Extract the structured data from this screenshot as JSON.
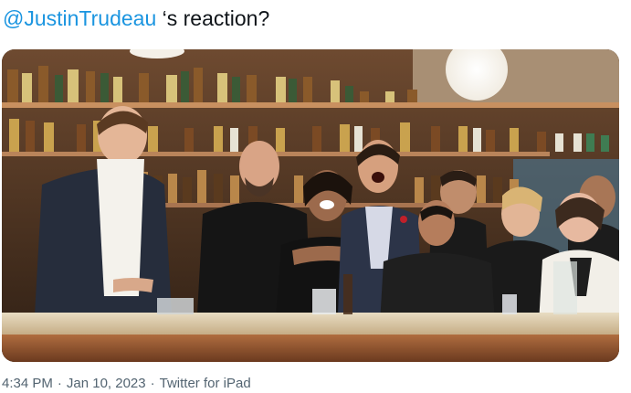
{
  "tweet": {
    "mention": "@JustinTrudeau",
    "text_after": " ‘s reaction?"
  },
  "media": {
    "kind": "photo",
    "accent_colors": {
      "wall": "#7a4d2e",
      "bar_top": "#d9c8a8",
      "bar_front": "#a0603a",
      "suit": "#2c3344",
      "shirt_black": "#141414"
    }
  },
  "footer": {
    "time": "4:34 PM",
    "date": "Jan 10, 2023",
    "source": "Twitter for iPad"
  }
}
